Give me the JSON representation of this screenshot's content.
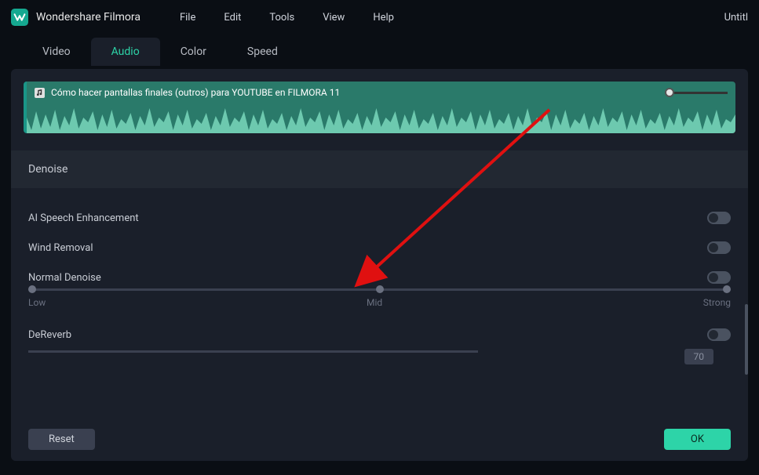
{
  "app": {
    "name": "Wondershare Filmora",
    "doc_title": "Untitl"
  },
  "menu": {
    "file": "File",
    "edit": "Edit",
    "tools": "Tools",
    "view": "View",
    "help": "Help"
  },
  "tabs": {
    "video": "Video",
    "audio": "Audio",
    "color": "Color",
    "speed": "Speed"
  },
  "clip": {
    "title": "Cómo hacer pantallas finales (outros) para YOUTUBE en FILMORA 11"
  },
  "section": {
    "denoise": "Denoise"
  },
  "settings": {
    "ai_speech": "AI Speech Enhancement",
    "wind_removal": "Wind Removal",
    "normal_denoise": "Normal Denoise",
    "dereverb": "DeReverb"
  },
  "slider": {
    "low": "Low",
    "mid": "Mid",
    "strong": "Strong"
  },
  "dereverb_value": "70",
  "buttons": {
    "reset": "Reset",
    "ok": "OK"
  }
}
